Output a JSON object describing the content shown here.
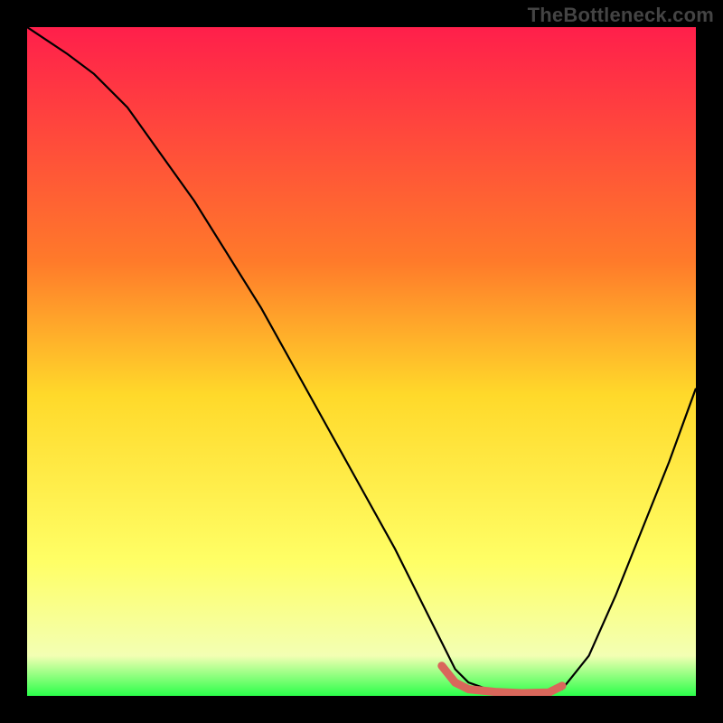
{
  "watermark": "TheBottleneck.com",
  "chart_data": {
    "type": "line",
    "title": "",
    "xlabel": "",
    "ylabel": "",
    "xlim": [
      0,
      100
    ],
    "ylim": [
      0,
      100
    ],
    "grid": false,
    "legend": false,
    "gradient_stops": [
      {
        "offset": 0,
        "color": "#ff1f4b"
      },
      {
        "offset": 35,
        "color": "#ff7a2a"
      },
      {
        "offset": 55,
        "color": "#ffd92a"
      },
      {
        "offset": 80,
        "color": "#ffff66"
      },
      {
        "offset": 94,
        "color": "#f3ffb3"
      },
      {
        "offset": 100,
        "color": "#2bff4a"
      }
    ],
    "series": [
      {
        "name": "bottleneck-curve",
        "color": "#000000",
        "x": [
          0,
          3,
          6,
          10,
          15,
          20,
          25,
          30,
          35,
          40,
          45,
          50,
          55,
          60,
          62,
          64,
          66,
          70,
          74,
          78,
          80,
          84,
          88,
          92,
          96,
          100
        ],
        "y": [
          100,
          98,
          96,
          93,
          88,
          81,
          74,
          66,
          58,
          49,
          40,
          31,
          22,
          12,
          8,
          4,
          2,
          0.6,
          0.4,
          0.5,
          1,
          6,
          15,
          25,
          35,
          46
        ]
      },
      {
        "name": "optimal-range-marker",
        "color": "#d9675b",
        "stroke_width": 9,
        "linecap": "round",
        "x": [
          62,
          64,
          66,
          70,
          74,
          78,
          80
        ],
        "y": [
          4.5,
          2.0,
          1.0,
          0.6,
          0.4,
          0.5,
          1.5
        ]
      }
    ]
  }
}
